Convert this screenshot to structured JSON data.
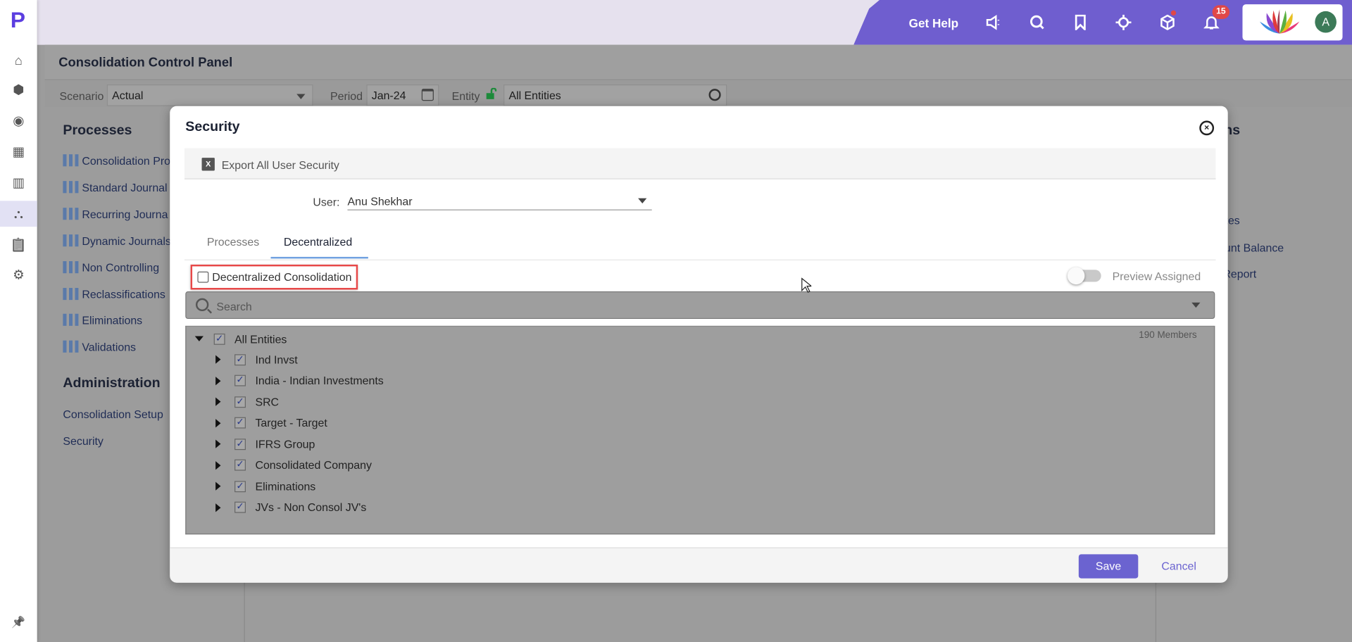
{
  "app": {
    "logo_letter": "P",
    "accent": "#6f5ecf"
  },
  "sidebar": {
    "items": [
      {
        "icon": "home-icon",
        "glyph": "⌂"
      },
      {
        "icon": "cube-icon",
        "glyph": "⬢"
      },
      {
        "icon": "target-icon",
        "glyph": "◉"
      },
      {
        "icon": "grid-icon",
        "glyph": "▦"
      },
      {
        "icon": "report-icon",
        "glyph": "▥"
      },
      {
        "icon": "hierarchy-icon",
        "glyph": "⛬",
        "active": true
      },
      {
        "icon": "clipboard-icon",
        "glyph": "📋"
      },
      {
        "icon": "gear-icon",
        "glyph": "⚙"
      }
    ],
    "pin_glyph": "📌"
  },
  "header": {
    "get_help": "Get Help",
    "notification_count": "15",
    "avatar_initial": "A"
  },
  "page": {
    "title": "Consolidation Control Panel",
    "filters": {
      "scenario_label": "Scenario",
      "scenario_value": "Actual",
      "period_label": "Period",
      "period_value": "Jan-24",
      "entity_label": "Entity",
      "entity_value": "All Entities"
    },
    "processes_heading": "Processes",
    "processes": [
      "Consolidation Pro",
      "Standard Journal",
      "Recurring Journa",
      "Dynamic Journals",
      "Non Controlling",
      "Reclassifications",
      "Eliminations",
      "Validations"
    ],
    "administration_heading": "Administration",
    "administration": [
      "Consolidation Setup",
      "Security"
    ],
    "right_heading_fragment": "tions",
    "right_items_fragments": [
      "Rates",
      "ccount Balance",
      "ed Report"
    ]
  },
  "modal": {
    "title": "Security",
    "export_label": "Export All User Security",
    "user_label": "User:",
    "user_value": "Anu Shekhar",
    "tabs": [
      {
        "label": "Processes",
        "active": false
      },
      {
        "label": "Decentralized",
        "active": true
      }
    ],
    "decentralized_label": "Decentralized Consolidation",
    "decentralized_checked": false,
    "preview_label": "Preview Assigned",
    "preview_on": false,
    "search_placeholder": "Search",
    "members_count": "190 Members",
    "tree_root": "All Entities",
    "tree_children": [
      "Ind Invst",
      "India - Indian Investments",
      "SRC",
      "Target - Target",
      "IFRS Group",
      "Consolidated Company",
      "Eliminations",
      "JVs - Non Consol JV's"
    ],
    "save_label": "Save",
    "cancel_label": "Cancel"
  }
}
